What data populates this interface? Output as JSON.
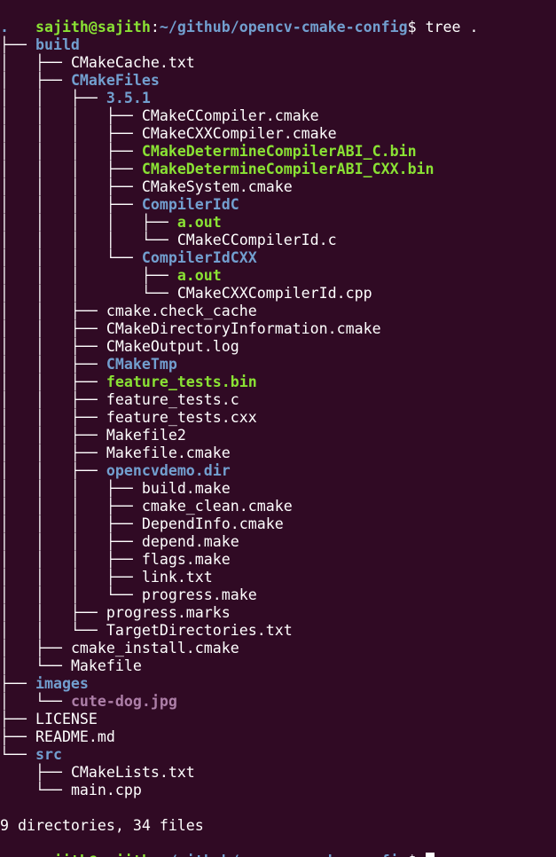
{
  "prompt": {
    "user_host": "sajith@sajith",
    "separator": ":",
    "path": "~/github/opencv-cmake-config",
    "symbol": "$",
    "command": " tree ."
  },
  "tree_root": ".",
  "tree": [
    {
      "prefix": "├── ",
      "name": "build",
      "type": "dir"
    },
    {
      "prefix": "│   ├── ",
      "name": "CMakeCache.txt",
      "type": "file"
    },
    {
      "prefix": "│   ├── ",
      "name": "CMakeFiles",
      "type": "dir"
    },
    {
      "prefix": "│   │   ├── ",
      "name": "3.5.1",
      "type": "dir"
    },
    {
      "prefix": "│   │   │   ├── ",
      "name": "CMakeCCompiler.cmake",
      "type": "file"
    },
    {
      "prefix": "│   │   │   ├── ",
      "name": "CMakeCXXCompiler.cmake",
      "type": "file"
    },
    {
      "prefix": "│   │   │   ├── ",
      "name": "CMakeDetermineCompilerABI_C.bin",
      "type": "exec"
    },
    {
      "prefix": "│   │   │   ├── ",
      "name": "CMakeDetermineCompilerABI_CXX.bin",
      "type": "exec"
    },
    {
      "prefix": "│   │   │   ├── ",
      "name": "CMakeSystem.cmake",
      "type": "file"
    },
    {
      "prefix": "│   │   │   ├── ",
      "name": "CompilerIdC",
      "type": "dir"
    },
    {
      "prefix": "│   │   │   │   ├── ",
      "name": "a.out",
      "type": "exec"
    },
    {
      "prefix": "│   │   │   │   └── ",
      "name": "CMakeCCompilerId.c",
      "type": "file"
    },
    {
      "prefix": "│   │   │   └── ",
      "name": "CompilerIdCXX",
      "type": "dir"
    },
    {
      "prefix": "│   │   │       ├── ",
      "name": "a.out",
      "type": "exec"
    },
    {
      "prefix": "│   │   │       └── ",
      "name": "CMakeCXXCompilerId.cpp",
      "type": "file"
    },
    {
      "prefix": "│   │   ├── ",
      "name": "cmake.check_cache",
      "type": "file"
    },
    {
      "prefix": "│   │   ├── ",
      "name": "CMakeDirectoryInformation.cmake",
      "type": "file"
    },
    {
      "prefix": "│   │   ├── ",
      "name": "CMakeOutput.log",
      "type": "file"
    },
    {
      "prefix": "│   │   ├── ",
      "name": "CMakeTmp",
      "type": "dir"
    },
    {
      "prefix": "│   │   ├── ",
      "name": "feature_tests.bin",
      "type": "exec"
    },
    {
      "prefix": "│   │   ├── ",
      "name": "feature_tests.c",
      "type": "file"
    },
    {
      "prefix": "│   │   ├── ",
      "name": "feature_tests.cxx",
      "type": "file"
    },
    {
      "prefix": "│   │   ├── ",
      "name": "Makefile2",
      "type": "file"
    },
    {
      "prefix": "│   │   ├── ",
      "name": "Makefile.cmake",
      "type": "file"
    },
    {
      "prefix": "│   │   ├── ",
      "name": "opencvdemo.dir",
      "type": "dir"
    },
    {
      "prefix": "│   │   │   ├── ",
      "name": "build.make",
      "type": "file"
    },
    {
      "prefix": "│   │   │   ├── ",
      "name": "cmake_clean.cmake",
      "type": "file"
    },
    {
      "prefix": "│   │   │   ├── ",
      "name": "DependInfo.cmake",
      "type": "file"
    },
    {
      "prefix": "│   │   │   ├── ",
      "name": "depend.make",
      "type": "file"
    },
    {
      "prefix": "│   │   │   ├── ",
      "name": "flags.make",
      "type": "file"
    },
    {
      "prefix": "│   │   │   ├── ",
      "name": "link.txt",
      "type": "file"
    },
    {
      "prefix": "│   │   │   └── ",
      "name": "progress.make",
      "type": "file"
    },
    {
      "prefix": "│   │   ├── ",
      "name": "progress.marks",
      "type": "file"
    },
    {
      "prefix": "│   │   └── ",
      "name": "TargetDirectories.txt",
      "type": "file"
    },
    {
      "prefix": "│   ├── ",
      "name": "cmake_install.cmake",
      "type": "file"
    },
    {
      "prefix": "│   └── ",
      "name": "Makefile",
      "type": "file"
    },
    {
      "prefix": "├── ",
      "name": "images",
      "type": "dir"
    },
    {
      "prefix": "│   └── ",
      "name": "cute-dog.jpg",
      "type": "image"
    },
    {
      "prefix": "├── ",
      "name": "LICENSE",
      "type": "file"
    },
    {
      "prefix": "├── ",
      "name": "README.md",
      "type": "file"
    },
    {
      "prefix": "└── ",
      "name": "src",
      "type": "dir"
    },
    {
      "prefix": "    ├── ",
      "name": "CMakeLists.txt",
      "type": "file"
    },
    {
      "prefix": "    └── ",
      "name": "main.cpp",
      "type": "file"
    }
  ],
  "summary": "9 directories, 34 files",
  "colors": {
    "background": "#300a24",
    "text": "#ffffff",
    "directory": "#729fcf",
    "executable": "#8ae234",
    "image": "#ad7fa8",
    "prompt_user": "#8ae234",
    "prompt_path": "#729fcf"
  }
}
